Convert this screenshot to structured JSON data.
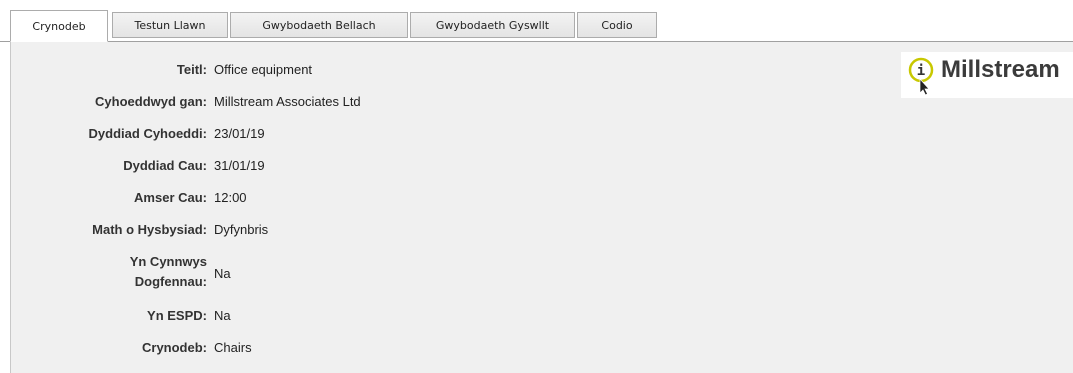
{
  "tabs": [
    {
      "label": "Crynodeb",
      "active": true
    },
    {
      "label": "Testun Llawn",
      "active": false
    },
    {
      "label": "Gwybodaeth Bellach",
      "active": false
    },
    {
      "label": "Gwybodaeth Gyswllt",
      "active": false
    },
    {
      "label": "Codio",
      "active": false
    }
  ],
  "fields": [
    {
      "label": "Teitl:",
      "value": "Office equipment"
    },
    {
      "label": "Cyhoeddwyd gan:",
      "value": "Millstream Associates Ltd"
    },
    {
      "label": "Dyddiad Cyhoeddi:",
      "value": "23/01/19"
    },
    {
      "label": "Dyddiad Cau:",
      "value": "31/01/19"
    },
    {
      "label": "Amser Cau:",
      "value": "12:00"
    },
    {
      "label": "Math o Hysbysiad:",
      "value": "Dyfynbris"
    },
    {
      "label_line1": "Yn Cynnwys",
      "label_line2": "Dogfennau:",
      "value": "Na"
    },
    {
      "label": "Yn ESPD:",
      "value": "Na"
    },
    {
      "label": "Crynodeb:",
      "value": "Chairs"
    }
  ],
  "logo": {
    "text": "Millstream",
    "icon": "info-cursor-icon",
    "icon_glyph": "i",
    "accent_color": "#c8c800"
  },
  "colors": {
    "panel_bg": "#f0f0f0",
    "tab_border": "#acacac"
  }
}
